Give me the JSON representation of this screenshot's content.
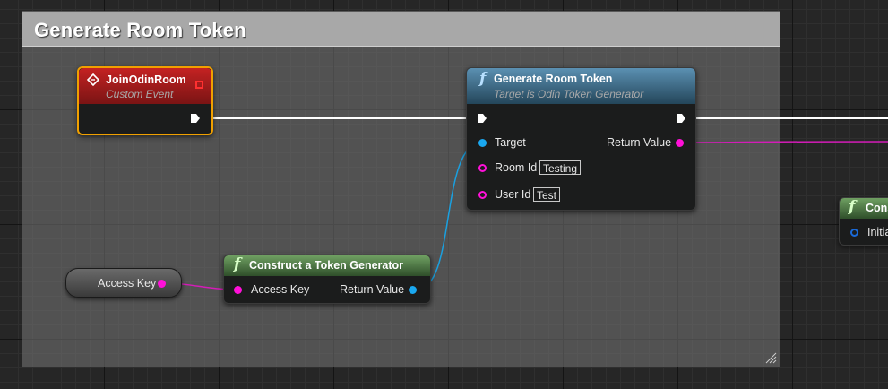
{
  "comment": {
    "title": "Generate Room Token"
  },
  "event_node": {
    "title": "JoinOdinRoom",
    "subtitle": "Custom Event"
  },
  "generate_node": {
    "title": "Generate Room Token",
    "subtitle": "Target is Odin Token Generator",
    "pins": {
      "target": "Target",
      "return_value": "Return Value",
      "room_id": "Room Id",
      "room_id_value": "Testing",
      "user_id": "User Id",
      "user_id_value": "Test"
    }
  },
  "construct_node": {
    "title": "Construct a Token Generator",
    "pins": {
      "access_key": "Access Key",
      "return_value": "Return Value"
    }
  },
  "variable_node": {
    "label": "Access Key"
  },
  "partial_node": {
    "title": "Cons",
    "pin": "Initia"
  },
  "colors": {
    "event_header": "#a51d1d",
    "function_header": "#4a7fa0",
    "pure_header": "#4f7d46",
    "string_pin": "#ff00d8",
    "object_pin": "#00a8f0",
    "exec_wire": "#ffffff",
    "selection": "#f0a000"
  }
}
